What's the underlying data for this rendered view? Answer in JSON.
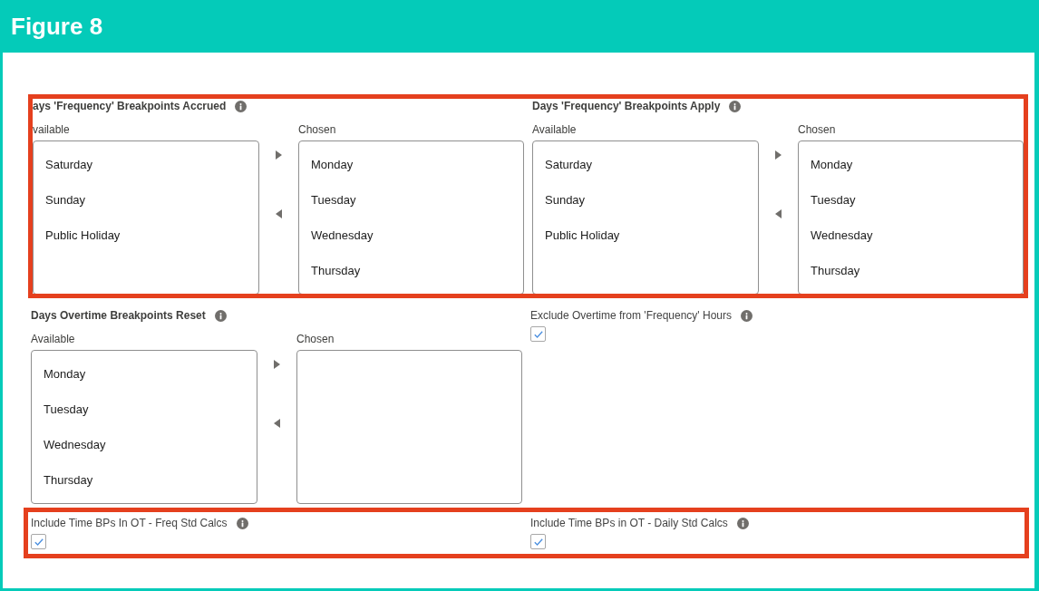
{
  "header": {
    "title": "Figure 8"
  },
  "sections": [
    {
      "highlighted": true,
      "fields": [
        {
          "kind": "dual_listbox",
          "label": "ays 'Frequency' Breakpoints Accrued",
          "available_label": "vailable",
          "chosen_label": "Chosen",
          "available": [
            "Saturday",
            "Sunday",
            "Public Holiday"
          ],
          "chosen": [
            "Monday",
            "Tuesday",
            "Wednesday",
            "Thursday"
          ]
        },
        {
          "kind": "dual_listbox",
          "label": "Days 'Frequency' Breakpoints Apply",
          "available_label": "Available",
          "chosen_label": "Chosen",
          "available": [
            "Saturday",
            "Sunday",
            "Public Holiday"
          ],
          "chosen": [
            "Monday",
            "Tuesday",
            "Wednesday",
            "Thursday"
          ]
        }
      ]
    },
    {
      "highlighted": false,
      "fields": [
        {
          "kind": "dual_listbox",
          "label": "Days Overtime Breakpoints Reset",
          "available_label": "Available",
          "chosen_label": "Chosen",
          "available": [
            "Monday",
            "Tuesday",
            "Wednesday",
            "Thursday"
          ]
        },
        {
          "kind": "checkbox",
          "label": "Exclude Overtime from 'Frequency' Hours",
          "checked": true
        }
      ]
    },
    {
      "highlighted": true,
      "fields": [
        {
          "kind": "checkbox",
          "label": "Include Time BPs In OT - Freq Std Calcs",
          "checked": true
        },
        {
          "kind": "checkbox",
          "label": "Include Time BPs in OT - Daily Std Calcs",
          "checked": true
        }
      ]
    }
  ]
}
